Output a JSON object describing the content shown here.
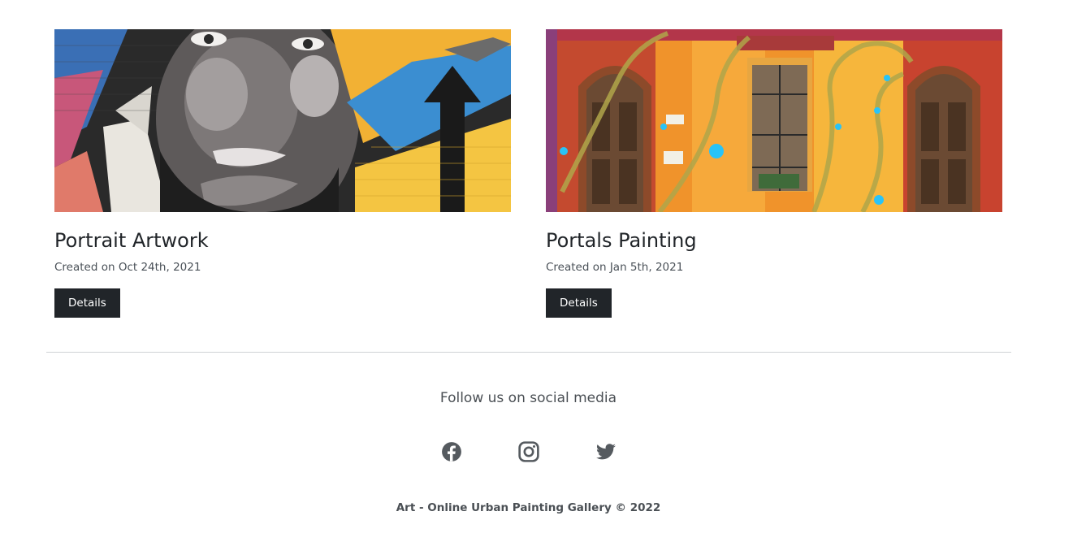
{
  "gallery": {
    "items": [
      {
        "title": "Portrait Artwork",
        "date": "Created on Oct 24th, 2021",
        "button_label": "Details",
        "image_alt": "street-art-portrait"
      },
      {
        "title": "Portals Painting",
        "date": "Created on Jan 5th, 2021",
        "button_label": "Details",
        "image_alt": "street-art-portals"
      }
    ]
  },
  "footer": {
    "follow_text": "Follow us on social media",
    "social": [
      {
        "name": "facebook-icon"
      },
      {
        "name": "instagram-icon"
      },
      {
        "name": "twitter-icon"
      }
    ],
    "copyright": "Art - Online Urban Painting Gallery © 2022"
  },
  "colors": {
    "button_bg": "#212529",
    "icon": "#555a5f",
    "divider": "#cfd3d6"
  }
}
